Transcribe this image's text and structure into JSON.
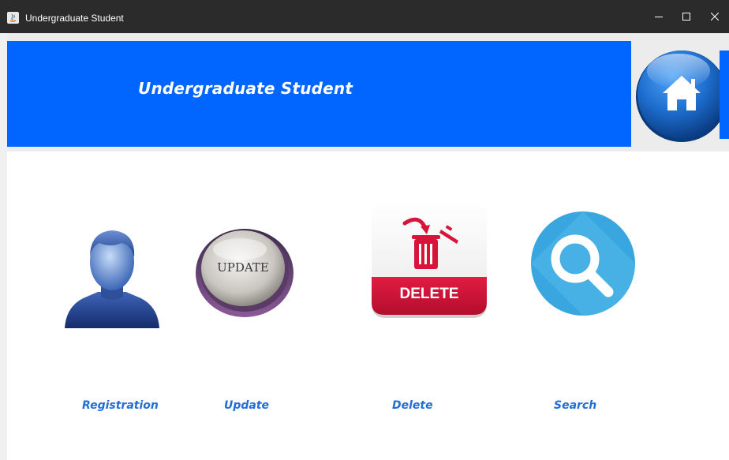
{
  "window": {
    "title": "Undergraduate Student",
    "controls": {
      "minimize": "minimize-icon",
      "maximize": "maximize-icon",
      "close": "close-icon"
    }
  },
  "header": {
    "title": "Undergraduate Student",
    "home_icon": "home-icon",
    "color": "#0066ff"
  },
  "tiles": [
    {
      "label": "Registration",
      "icon": "user-icon"
    },
    {
      "label": "Update",
      "icon": "update-icon",
      "icon_text": "UPDATE"
    },
    {
      "label": "Delete",
      "icon": "trash-icon",
      "icon_text": "DELETE"
    },
    {
      "label": "Search",
      "icon": "search-icon"
    }
  ],
  "colors": {
    "label": "#1f6fd6",
    "titlebar": "#2b2b2b",
    "delete_red": "#d8143a",
    "search_blue": "#3aa6e0"
  }
}
